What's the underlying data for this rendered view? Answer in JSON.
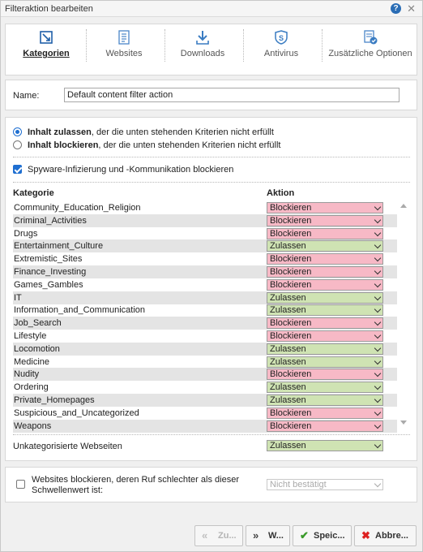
{
  "window": {
    "title": "Filteraktion bearbeiten"
  },
  "tabs": [
    {
      "label": "Kategorien",
      "icon": "crop-edit-icon",
      "active": true
    },
    {
      "label": "Websites",
      "icon": "webpage-icon",
      "active": false
    },
    {
      "label": "Downloads",
      "icon": "download-icon",
      "active": false
    },
    {
      "label": "Antivirus",
      "icon": "shield-icon",
      "active": false
    },
    {
      "label": "Zusätzliche Optionen",
      "icon": "options-check-icon",
      "active": false
    }
  ],
  "name": {
    "label": "Name:",
    "value": "Default content filter action"
  },
  "mode": {
    "allow_bold": "Inhalt zulassen",
    "allow_rest": ", der die unten stehenden Kriterien nicht erfüllt",
    "block_bold": "Inhalt blockieren",
    "block_rest": ", der die unten stehenden Kriterien nicht erfüllt",
    "selected": "allow"
  },
  "spyware": {
    "label": "Spyware-Infizierung und -Kommunikation blockieren",
    "checked": true
  },
  "table": {
    "col_category": "Kategorie",
    "col_action": "Aktion",
    "rows": [
      {
        "name": "Community_Education_Religion",
        "action": "Blockieren"
      },
      {
        "name": "Criminal_Activities",
        "action": "Blockieren"
      },
      {
        "name": "Drugs",
        "action": "Blockieren"
      },
      {
        "name": "Entertainment_Culture",
        "action": "Zulassen"
      },
      {
        "name": "Extremistic_Sites",
        "action": "Blockieren"
      },
      {
        "name": "Finance_Investing",
        "action": "Blockieren"
      },
      {
        "name": "Games_Gambles",
        "action": "Blockieren"
      },
      {
        "name": "IT",
        "action": "Zulassen"
      },
      {
        "name": "Information_and_Communication",
        "action": "Zulassen"
      },
      {
        "name": "Job_Search",
        "action": "Blockieren"
      },
      {
        "name": "Lifestyle",
        "action": "Blockieren"
      },
      {
        "name": "Locomotion",
        "action": "Zulassen"
      },
      {
        "name": "Medicine",
        "action": "Zulassen"
      },
      {
        "name": "Nudity",
        "action": "Blockieren"
      },
      {
        "name": "Ordering",
        "action": "Zulassen"
      },
      {
        "name": "Private_Homepages",
        "action": "Zulassen"
      },
      {
        "name": "Suspicious_and_Uncategorized",
        "action": "Blockieren"
      },
      {
        "name": "Weapons",
        "action": "Blockieren"
      }
    ]
  },
  "uncategorized": {
    "label": "Unkategorisierte Webseiten",
    "action": "Zulassen"
  },
  "reputation": {
    "label": "Websites blockieren, deren Ruf schlechter als dieser Schwellenwert ist:",
    "checked": false,
    "placeholder": "Nicht bestätigt"
  },
  "buttons": {
    "back": "Zu...",
    "next": "W...",
    "save": "Speic...",
    "cancel": "Abbre..."
  },
  "colors": {
    "block_bg": "#f7b9c6",
    "allow_bg": "#cfe3b3",
    "accent": "#1f6fd1",
    "icon_blue": "#2a6db5"
  }
}
